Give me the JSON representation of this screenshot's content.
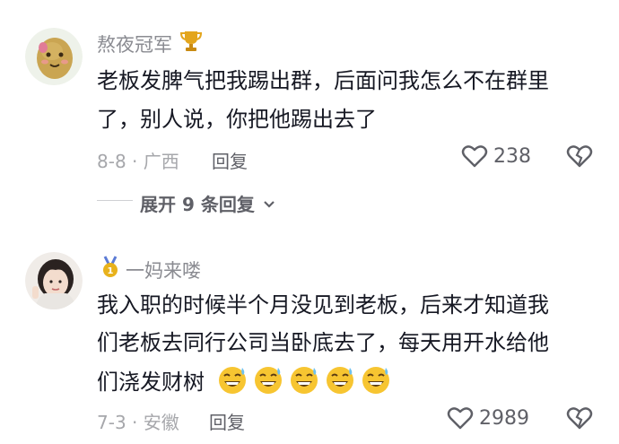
{
  "comments": [
    {
      "username": "熬夜冠军",
      "badge_icon": "trophy-icon",
      "text_line1": "老板发脾气把我踢出群，后面问我怎么不在群里",
      "text_line2": "了，别人说，你把他踢出去了",
      "date_location": "8-8 · 广西",
      "reply_label": "回复",
      "like_count": "238",
      "expand_replies": "展开 9 条回复"
    },
    {
      "username": "一妈来喽",
      "badge_icon": "medal-icon",
      "text_line1": "我入职的时候半个月没见到老板，后来才知道我",
      "text_line2": "们老板去同行公司当卧底去了，每天用开水给他",
      "text_line3": "们浇发财树",
      "emoji_icon": "grinning-sweat-emoji",
      "date_location": "7-3 · 安徽",
      "reply_label": "回复",
      "like_count": "2989"
    }
  ]
}
